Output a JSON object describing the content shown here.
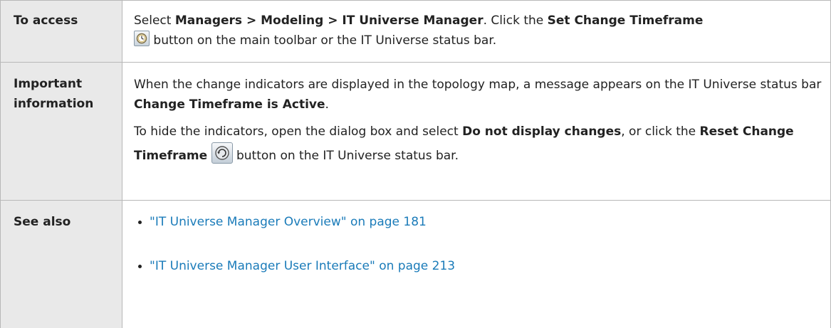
{
  "rows": {
    "access": {
      "header": "To access",
      "t1": "Select ",
      "b1": "Managers > Modeling > IT Universe Manager",
      "t2": ". Click the ",
      "b2": "Set Change Timeframe",
      "t3": " button on the main toolbar or the IT Universe status bar.",
      "icon": "set-change-timeframe-icon"
    },
    "important": {
      "header_line1": "Important",
      "header_line2": "information",
      "p1_t1": "When the change indicators are displayed in the topology map, a message appears on the IT Universe status bar ",
      "p1_b1": "Change Timeframe is Active",
      "p1_t2": ".",
      "p2_t1": "To hide the indicators, open the dialog box and select ",
      "p2_b1": "Do not display changes",
      "p2_t2": ", or click the ",
      "p2_b2": "Reset Change Timeframe",
      "p2_t3": " button on the IT Universe status bar.",
      "icon": "reset-change-timeframe-icon"
    },
    "see_also": {
      "header": "See also",
      "links": [
        "\"IT Universe Manager Overview\" on page 181",
        "\"IT Universe Manager User Interface\" on page 213"
      ]
    }
  },
  "colors": {
    "header_bg": "#e9e9e9",
    "border": "#b8b8b8",
    "link": "#1a7bb9",
    "text": "#222222"
  }
}
